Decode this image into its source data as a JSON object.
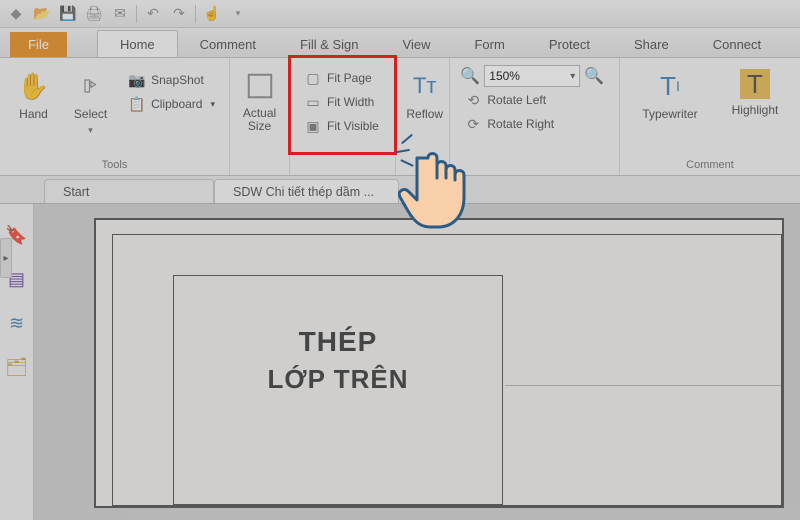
{
  "colors": {
    "accent": "#e88b1a",
    "highlight": "#d42020"
  },
  "qat": {
    "items": [
      "new",
      "open",
      "save",
      "print",
      "mail",
      "undo",
      "redo",
      "touch-mode"
    ]
  },
  "tabs": {
    "file": "File",
    "items": [
      "Home",
      "Comment",
      "Fill & Sign",
      "View",
      "Form",
      "Protect",
      "Share",
      "Connect"
    ],
    "active": "Home"
  },
  "ribbon": {
    "tools_group_label": "Tools",
    "hand": "Hand",
    "select": "Select",
    "snapshot": "SnapShot",
    "clipboard": "Clipboard",
    "actual_size": "Actual\nSize",
    "fit_page": "Fit Page",
    "fit_width": "Fit Width",
    "fit_visible": "Fit Visible",
    "reflow": "Reflow",
    "zoom_value": "150%",
    "rotate_left": "Rotate Left",
    "rotate_right": "Rotate Right",
    "typewriter": "Typewriter",
    "highlight": "Highlight",
    "comment_group_label": "Comment"
  },
  "doctabs": {
    "start": "Start",
    "doc": "SDW Chi tiết thép dầm ..."
  },
  "sheet": {
    "title1": "THÉP",
    "title2": "LỚP TRÊN"
  }
}
